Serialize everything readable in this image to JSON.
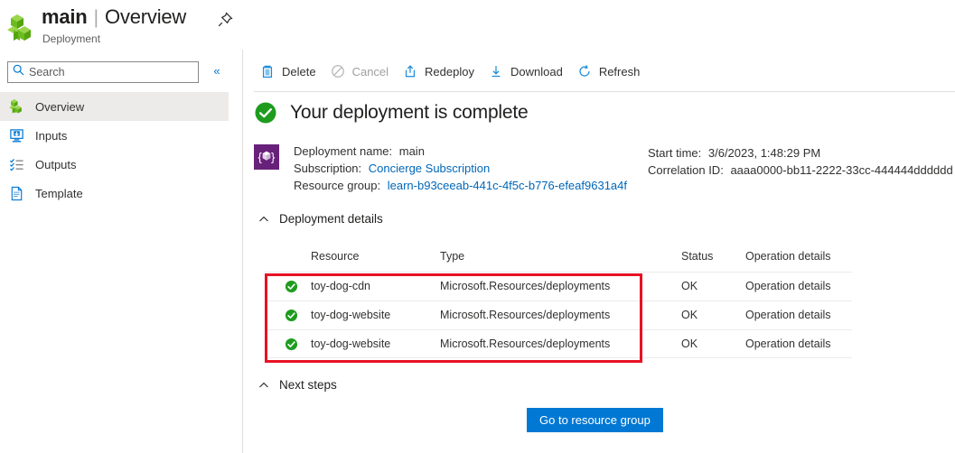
{
  "blade": {
    "logo_icon": "resource-group-cubes-icon",
    "title_main": "main",
    "title_separator": "|",
    "title_sub": "Overview",
    "subtitle": "Deployment",
    "pin_icon": "pin-icon",
    "ellipsis_icon": "more-options-icon"
  },
  "search": {
    "placeholder": "Search",
    "value": "",
    "icon": "search-icon",
    "collapse_icon": "double-chevron-left-icon",
    "collapse_label": "«"
  },
  "sidebar": {
    "items": [
      {
        "label": "Overview",
        "icon": "resource-group-cubes-icon",
        "selected": true
      },
      {
        "label": "Inputs",
        "icon": "inputs-monitor-icon",
        "selected": false
      },
      {
        "label": "Outputs",
        "icon": "outputs-list-icon",
        "selected": false
      },
      {
        "label": "Template",
        "icon": "template-document-icon",
        "selected": false
      }
    ]
  },
  "toolbar": {
    "buttons": [
      {
        "label": "Delete",
        "icon": "trash-icon",
        "disabled": false
      },
      {
        "label": "Cancel",
        "icon": "cancel-circle-slash-icon",
        "disabled": true
      },
      {
        "label": "Redeploy",
        "icon": "redeploy-upload-icon",
        "disabled": false
      },
      {
        "label": "Download",
        "icon": "download-arrow-icon",
        "disabled": false
      },
      {
        "label": "Refresh",
        "icon": "refresh-circle-icon",
        "disabled": false
      }
    ]
  },
  "status": {
    "icon": "success-check-circle-icon",
    "title": "Your deployment is complete"
  },
  "deployment_meta": {
    "icon": "deployment-template-braces-icon",
    "left": [
      {
        "key": "Deployment name:",
        "value": "main",
        "is_link": false
      },
      {
        "key": "Subscription:",
        "value": "Concierge Subscription",
        "is_link": true
      },
      {
        "key": "Resource group:",
        "value": "learn-b93ceeab-441c-4f5c-b776-efeaf9631a4f",
        "is_link": true
      }
    ],
    "right": [
      {
        "key": "Start time:",
        "value": "3/6/2023, 1:48:29 PM",
        "is_link": false
      },
      {
        "key": "Correlation ID:",
        "value": "aaaa0000-bb11-2222-33cc-444444dddddd",
        "is_link": false
      }
    ]
  },
  "deployment_details": {
    "section_title": "Deployment details",
    "chevron_icon": "chevron-up-icon",
    "columns": [
      "Resource",
      "Type",
      "Status",
      "Operation details"
    ],
    "rows": [
      {
        "status_icon": "success-check-circle-icon",
        "resource": "toy-dog-cdn",
        "type": "Microsoft.Resources/deployments",
        "status": "OK",
        "operation_details": "Operation details"
      },
      {
        "status_icon": "success-check-circle-icon",
        "resource": "toy-dog-website",
        "type": "Microsoft.Resources/deployments",
        "status": "OK",
        "operation_details": "Operation details"
      },
      {
        "status_icon": "success-check-circle-icon",
        "resource": "toy-dog-website",
        "type": "Microsoft.Resources/deployments",
        "status": "OK",
        "operation_details": "Operation details"
      }
    ],
    "highlight_color": "#e81123"
  },
  "next_steps": {
    "section_title": "Next steps",
    "chevron_icon": "chevron-up-icon",
    "button_label": "Go to resource group"
  },
  "colors": {
    "accent": "#0078d4",
    "link": "#0067b8",
    "success": "#107c10",
    "highlight": "#e81123",
    "deployment_icon_bg": "#68217a"
  }
}
